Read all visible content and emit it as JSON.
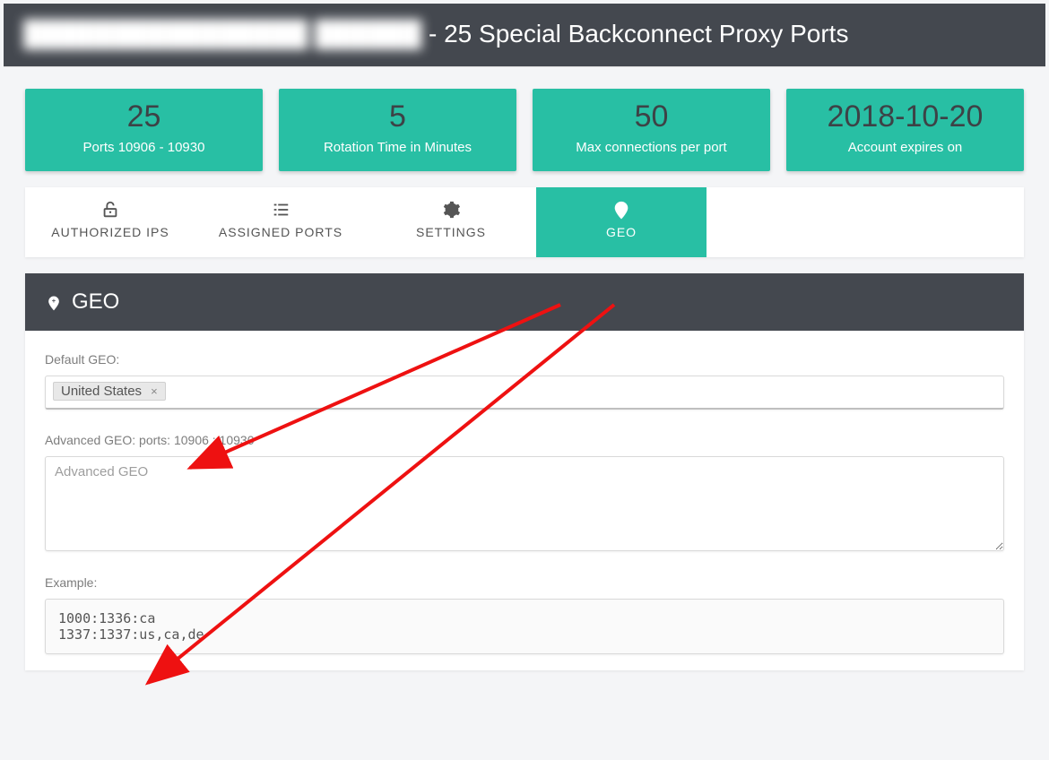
{
  "header": {
    "hidden_prefix": "████████████████ ██████",
    "title_suffix": " - 25 Special Backconnect Proxy Ports"
  },
  "stats": [
    {
      "value": "25",
      "label": "Ports 10906 - 10930"
    },
    {
      "value": "5",
      "label": "Rotation Time in Minutes"
    },
    {
      "value": "50",
      "label": "Max connections per port"
    },
    {
      "value": "2018-10-20",
      "label": "Account expires on"
    }
  ],
  "tabs": {
    "authorized_ips": "AUTHORIZED IPS",
    "assigned_ports": "ASSIGNED PORTS",
    "settings": "SETTINGS",
    "geo": "GEO",
    "active": "geo"
  },
  "geo_panel": {
    "title": "GEO",
    "default_label": "Default GEO:",
    "default_chip": "United States",
    "advanced_label": "Advanced GEO: ports: 10906 : 10930",
    "advanced_placeholder": "Advanced GEO",
    "advanced_value": "",
    "example_label": "Example:",
    "example_text": "1000:1336:ca\n1337:1337:us,ca,de"
  }
}
